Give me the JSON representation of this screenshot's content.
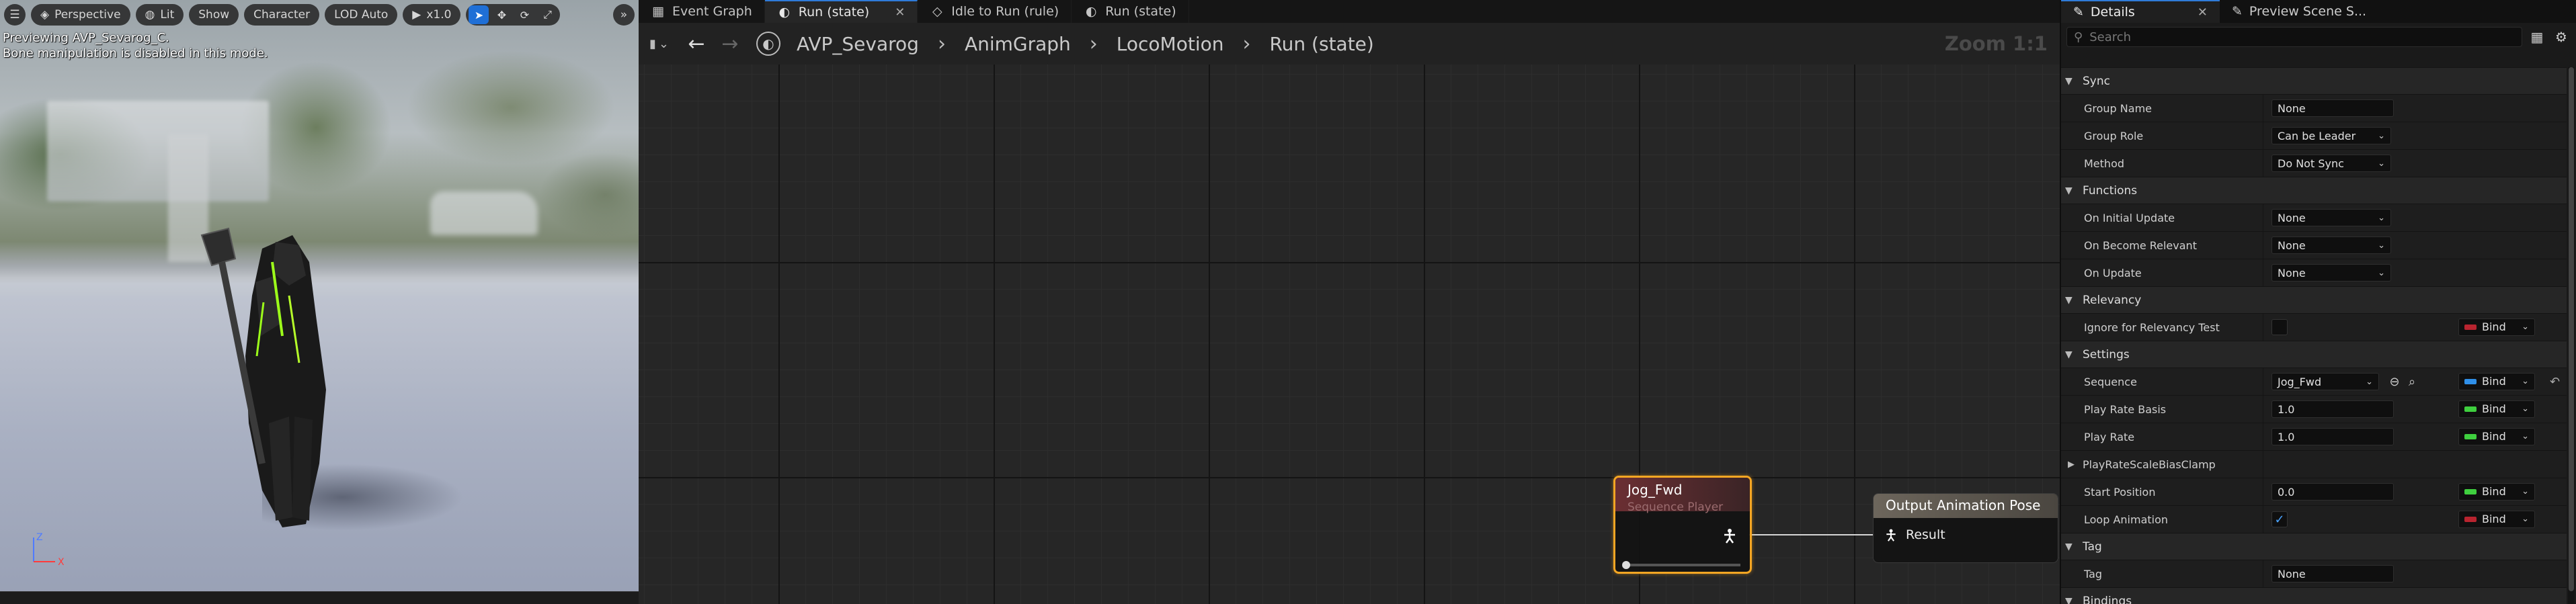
{
  "viewport": {
    "menu_icon": "hamburger-icon",
    "perspective": "Perspective",
    "lit": "Lit",
    "show": "Show",
    "character": "Character",
    "lod": "LOD Auto",
    "speed": "x1.0",
    "overlay_line1": "Previewing AVP_Sevarog_C.",
    "overlay_line2": "Bone manipulation is disabled in this mode.",
    "axis_z": "Z",
    "axis_x": "X"
  },
  "graph": {
    "tabs": [
      {
        "label": "Event Graph",
        "icon": "event-graph-icon"
      },
      {
        "label": "Run (state)",
        "icon": "state-icon",
        "active": true
      },
      {
        "label": "Idle to Run (rule)",
        "icon": "rule-icon"
      },
      {
        "label": "Run (state)",
        "icon": "state-icon"
      }
    ],
    "breadcrumbs": [
      "AVP_Sevarog",
      "AnimGraph",
      "LocoMotion",
      "Run (state)"
    ],
    "zoom": "Zoom 1:1",
    "nodes": {
      "sequence_player": {
        "title": "Jog_Fwd",
        "subtitle": "Sequence Player"
      },
      "output_pose": {
        "title": "Output Animation Pose",
        "pin": "Result"
      }
    }
  },
  "details": {
    "tabs": [
      {
        "label": "Details",
        "active": true
      },
      {
        "label": "Preview Scene S..."
      }
    ],
    "search_placeholder": "Search",
    "categories": {
      "sync": "Sync",
      "functions": "Functions",
      "relevancy": "Relevancy",
      "settings": "Settings",
      "tag": "Tag",
      "bindings": "Bindings"
    },
    "props": {
      "group_name": {
        "label": "Group Name",
        "value": "None"
      },
      "group_role": {
        "label": "Group Role",
        "value": "Can be Leader"
      },
      "method": {
        "label": "Method",
        "value": "Do Not Sync"
      },
      "on_initial_update": {
        "label": "On Initial Update",
        "value": "None"
      },
      "on_become_relevant": {
        "label": "On Become Relevant",
        "value": "None"
      },
      "on_update": {
        "label": "On Update",
        "value": "None"
      },
      "ignore_relevancy": {
        "label": "Ignore for Relevancy Test",
        "checked": false
      },
      "sequence": {
        "label": "Sequence",
        "value": "Jog_Fwd"
      },
      "play_rate_basis": {
        "label": "Play Rate Basis",
        "value": "1.0"
      },
      "play_rate": {
        "label": "Play Rate",
        "value": "1.0"
      },
      "play_rate_clamp": {
        "label": "PlayRateScaleBiasClamp"
      },
      "start_position": {
        "label": "Start Position",
        "value": "0.0"
      },
      "loop_animation": {
        "label": "Loop Animation",
        "checked": true
      },
      "tag": {
        "label": "Tag",
        "value": "None"
      }
    },
    "bind_label": "Bind",
    "colors": {
      "bind_red": "#b8242f",
      "bind_green": "#3fcf3f",
      "bind_blue": "#2f8fe8",
      "accent": "#2f7bd9",
      "selected_node": "#f5a623"
    }
  }
}
